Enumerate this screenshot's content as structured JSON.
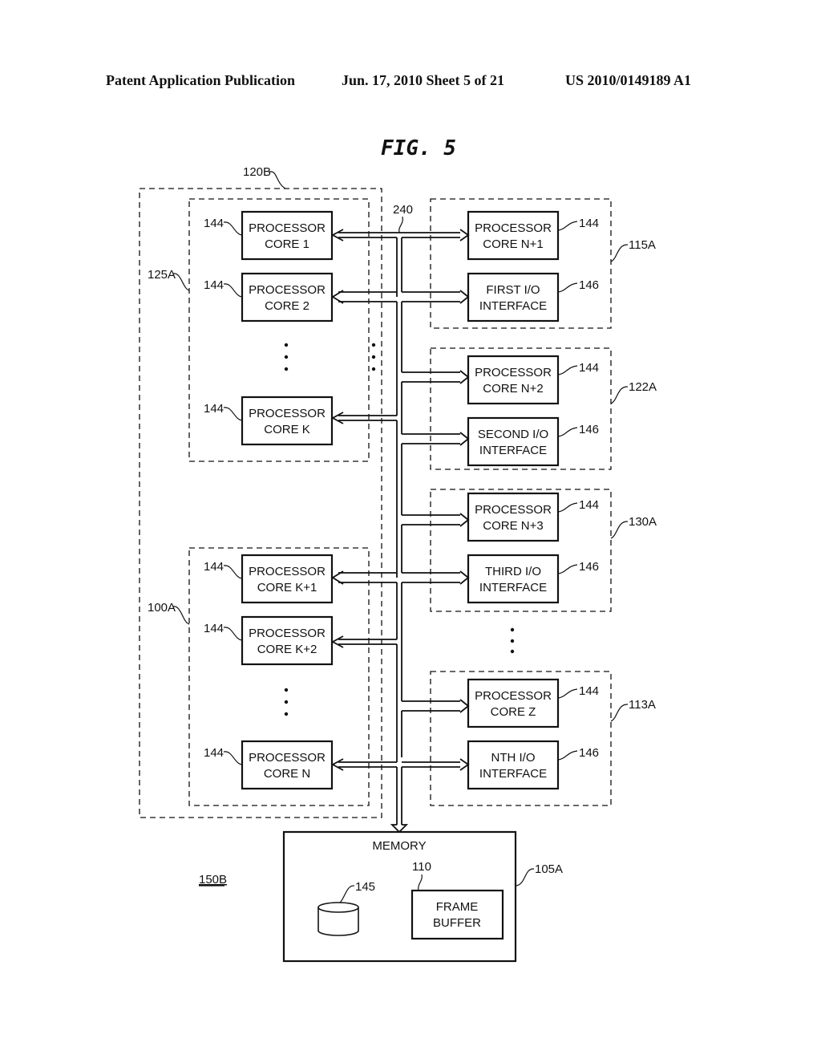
{
  "header": {
    "left": "Patent Application Publication",
    "center": "Jun. 17, 2010  Sheet 5 of 21",
    "right": "US 2010/0149189 A1"
  },
  "figure": {
    "title": "FIG. 5",
    "system_label": "150B",
    "bus_label": "240",
    "outer_group": {
      "label": "120B"
    },
    "left_groups": [
      {
        "label": "125A",
        "cores": [
          {
            "line1": "PROCESSOR",
            "line2": "CORE 1",
            "ref": "144"
          },
          {
            "line1": "PROCESSOR",
            "line2": "CORE 2",
            "ref": "144"
          },
          {
            "line1": "PROCESSOR",
            "line2": "CORE K",
            "ref": "144"
          }
        ]
      },
      {
        "label": "100A",
        "cores": [
          {
            "line1": "PROCESSOR",
            "line2": "CORE K+1",
            "ref": "144"
          },
          {
            "line1": "PROCESSOR",
            "line2": "CORE K+2",
            "ref": "144"
          },
          {
            "line1": "PROCESSOR",
            "line2": "CORE N",
            "ref": "144"
          }
        ]
      }
    ],
    "right_groups": [
      {
        "label": "115A",
        "core": {
          "line1": "PROCESSOR",
          "line2": "CORE N+1",
          "ref": "144"
        },
        "io": {
          "line1": "FIRST I/O",
          "line2": "INTERFACE",
          "ref": "146"
        }
      },
      {
        "label": "122A",
        "core": {
          "line1": "PROCESSOR",
          "line2": "CORE N+2",
          "ref": "144"
        },
        "io": {
          "line1": "SECOND I/O",
          "line2": "INTERFACE",
          "ref": "146"
        }
      },
      {
        "label": "130A",
        "core": {
          "line1": "PROCESSOR",
          "line2": "CORE N+3",
          "ref": "144"
        },
        "io": {
          "line1": "THIRD I/O",
          "line2": "INTERFACE",
          "ref": "146"
        }
      },
      {
        "label": "113A",
        "core": {
          "line1": "PROCESSOR",
          "line2": "CORE Z",
          "ref": "144"
        },
        "io": {
          "line1": "NTH I/O",
          "line2": "INTERFACE",
          "ref": "146"
        }
      }
    ],
    "memory": {
      "title": "MEMORY",
      "ref": "105A",
      "storage_ref": "145",
      "frame_buffer": {
        "line1": "FRAME",
        "line2": "BUFFER",
        "ref": "110"
      }
    }
  }
}
